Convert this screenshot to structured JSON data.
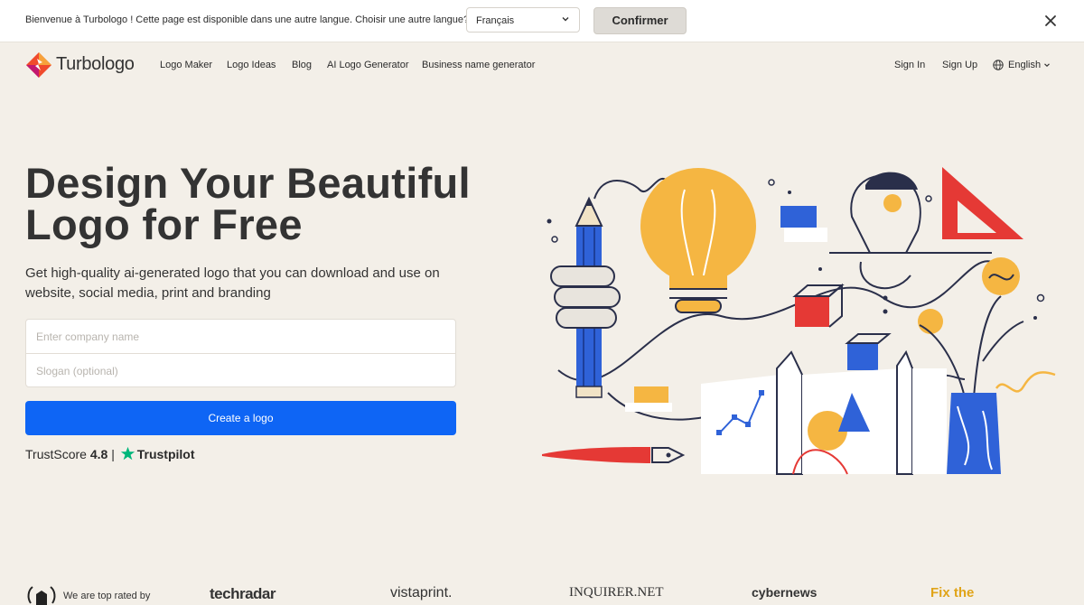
{
  "lang_banner": {
    "message": "Bienvenue à Turbologo ! Cette page est disponible dans une autre langue. Choisir une autre langue?",
    "selected_language": "Français",
    "confirm_label": "Confirmer",
    "close_icon": "close-icon"
  },
  "nav": {
    "logo_text": "Turbologo",
    "links": [
      "Logo Maker",
      "Logo Ideas",
      "Blog",
      "AI Logo Generator",
      "Business name generator"
    ],
    "sign_in": "Sign In",
    "sign_up": "Sign Up",
    "language": "English"
  },
  "hero": {
    "title_line1": "Design Your Beautiful",
    "title_line2": "Logo for Free",
    "subtitle": "Get high-quality ai-generated logo that you can download and use on website, social media, print and branding",
    "company_placeholder": "Enter company name",
    "slogan_placeholder": "Slogan (optional)",
    "cta_label": "Create a logo",
    "trust_label": "TrustScore",
    "trust_score": "4.8",
    "trust_sep": "|",
    "trust_brand": "Trustpilot"
  },
  "press": {
    "lead": "We are top rated by",
    "outlets": [
      "techradar",
      "vistaprint.",
      "INQUIRER.NET",
      "cybernews",
      "Fix the"
    ]
  },
  "colors": {
    "background": "#f3efe8",
    "primary": "#0e65f5",
    "trustpilot_green": "#00b67a",
    "accent_yellow": "#f5b642",
    "accent_red": "#e53935",
    "accent_blue": "#2f62d8"
  }
}
